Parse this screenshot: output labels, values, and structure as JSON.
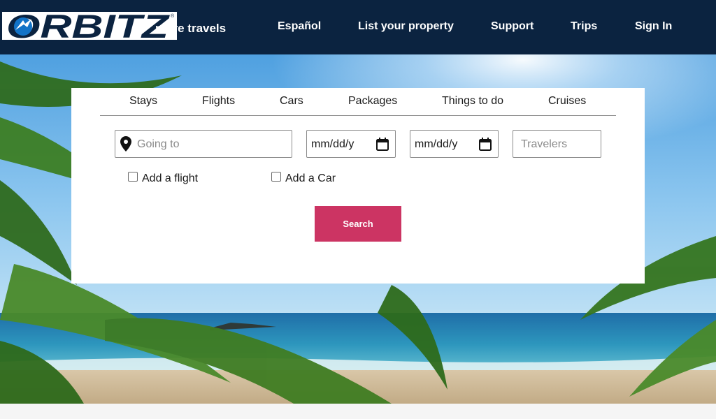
{
  "header": {
    "logo_text": "ORBITZ",
    "tagline": "more travels",
    "nav": [
      "Español",
      "List your property",
      "Support",
      "Trips",
      "Sign In"
    ]
  },
  "search": {
    "tabs": [
      "Stays",
      "Flights",
      "Cars",
      "Packages",
      "Things to do",
      "Cruises"
    ],
    "destination_placeholder": "Going to",
    "checkin_value": "mm/dd/y",
    "checkout_value": "mm/dd/y",
    "travelers_placeholder": "Travelers",
    "add_flight_label": "Add a flight",
    "add_car_label": "Add a Car",
    "search_label": "Search"
  },
  "icons": {
    "destination": "map-pin-icon",
    "checkin": "calendar-icon",
    "checkout": "calendar-icon"
  },
  "colors": {
    "header_bg": "#0b2340",
    "logo_blue": "#1273c7",
    "search_button": "#cc3463"
  }
}
